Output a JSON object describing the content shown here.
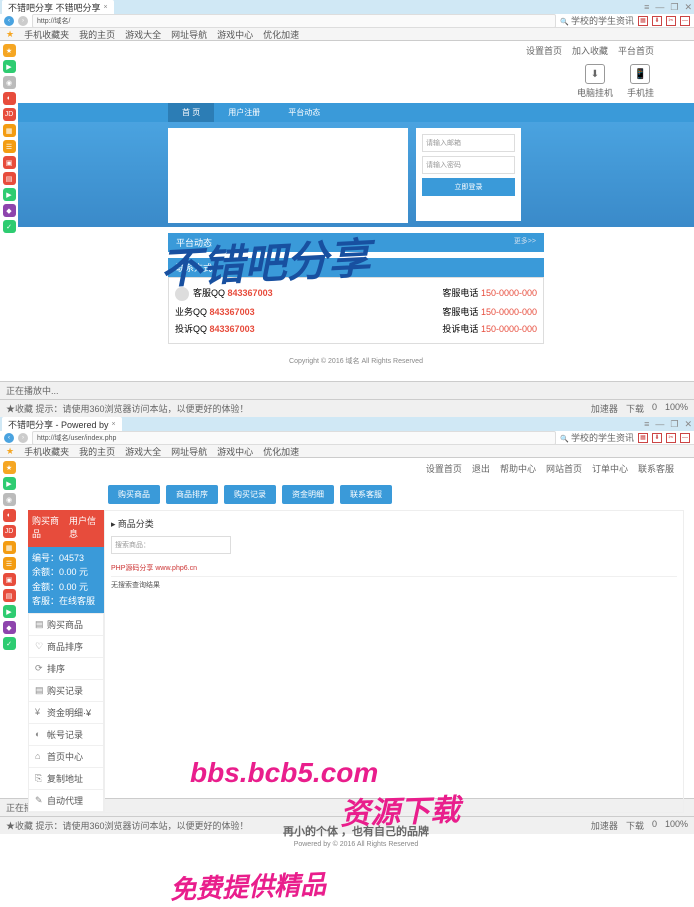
{
  "watermarks": {
    "w1": "不错吧分享",
    "w2": "bbs.bcb5.com",
    "w3": "资源下载",
    "w4": "免费提供精品"
  },
  "browser": {
    "tab1_title": "不错吧分享 不错吧分享",
    "tab2_title": "不错吧分享 - Powered by",
    "url1": "http://域名/",
    "url2": "http://域名/user/index.php",
    "bookmarks": [
      "手机收藏夹",
      "我的主页",
      "游戏大全",
      "网址导航",
      "游戏中心",
      "优化加速"
    ],
    "right_label": "学校的学生资讯",
    "win": {
      "min": "—",
      "max": "❐",
      "close": "✕",
      "menu": "≡"
    }
  },
  "sidebar_colors": [
    "#f5a623",
    "#2ecc71",
    "#bbb",
    "#e74c3c",
    "#e74c3c",
    "#f39c12",
    "#f39c12",
    "#e74c3c",
    "#e74c3c",
    "#2ecc71",
    "#8e44ad",
    "#2ecc71"
  ],
  "page1": {
    "top_links": [
      "设置首页",
      "加入收藏",
      "平台首页"
    ],
    "app1": {
      "icon": "⬇",
      "label": "电脑挂机"
    },
    "app2": {
      "icon": "📱",
      "label": "手机挂"
    },
    "nav": [
      "首 页",
      "用户注册",
      "平台动态"
    ],
    "login": {
      "ph1": "请输入邮箱",
      "ph2": "请输入密码",
      "btn": "立即登录"
    },
    "sec1_title": "平台动态",
    "sec1_more": "更多>>",
    "sec2_title": "联系方式",
    "contacts": [
      {
        "l": "客服QQ",
        "lv": "843367003",
        "r": "客服电话",
        "rv": "150-0000-000"
      },
      {
        "l": "业务QQ",
        "lv": "843367003",
        "r": "客服电话",
        "rv": "150-0000-000"
      },
      {
        "l": "投诉QQ",
        "lv": "843367003",
        "r": "投诉电话",
        "rv": "150-0000-000"
      }
    ],
    "footer": "Copyright © 2016 域名 All Rights Reserved",
    "status_l1": "正在播放中...",
    "status_l2": "★收藏  提示：请使用360浏览器访问本站，以便更好的体验！",
    "status_r": [
      "加速器",
      "下载",
      "0",
      "100%"
    ]
  },
  "page2": {
    "header": "不错吧分享 - Powered by",
    "topnav": [
      "设置首页",
      "退出",
      "帮助中心",
      "网站首页",
      "订单中心",
      "联系客服"
    ],
    "buttons": [
      "购买商品",
      "商品排序",
      "购买记录",
      "资金明细",
      "联系客服"
    ],
    "side_tabs": [
      "购买商品",
      "用户信息"
    ],
    "side_info": {
      "l1": "编号：04573",
      "l2": "余额：0.00 元",
      "l3": "金额：0.00 元",
      "l4": "客服：在线客服"
    },
    "menu": [
      {
        "i": "▤",
        "t": "购买商品"
      },
      {
        "i": "♡",
        "t": "商品排序"
      },
      {
        "i": "⟳",
        "t": "排序"
      },
      {
        "i": "▤",
        "t": "购买记录"
      },
      {
        "i": "¥",
        "t": "资金明细·¥"
      },
      {
        "i": "◐",
        "t": "帐号记录"
      },
      {
        "i": "⌂",
        "t": "首页中心"
      },
      {
        "i": "⎘",
        "t": "复制地址"
      },
      {
        "i": "✎",
        "t": "自动代理"
      }
    ],
    "crumb_icon": "▸",
    "crumb": "商品分类",
    "search_ph": "搜索商品：",
    "row1": "PHP源码分享 www.php6.cn",
    "row2": "无搜索查询结果",
    "footer_main": "再小的个体 ，也有自己的品牌",
    "footer_sub": "Powered by © 2016 All Rights Reserved"
  }
}
